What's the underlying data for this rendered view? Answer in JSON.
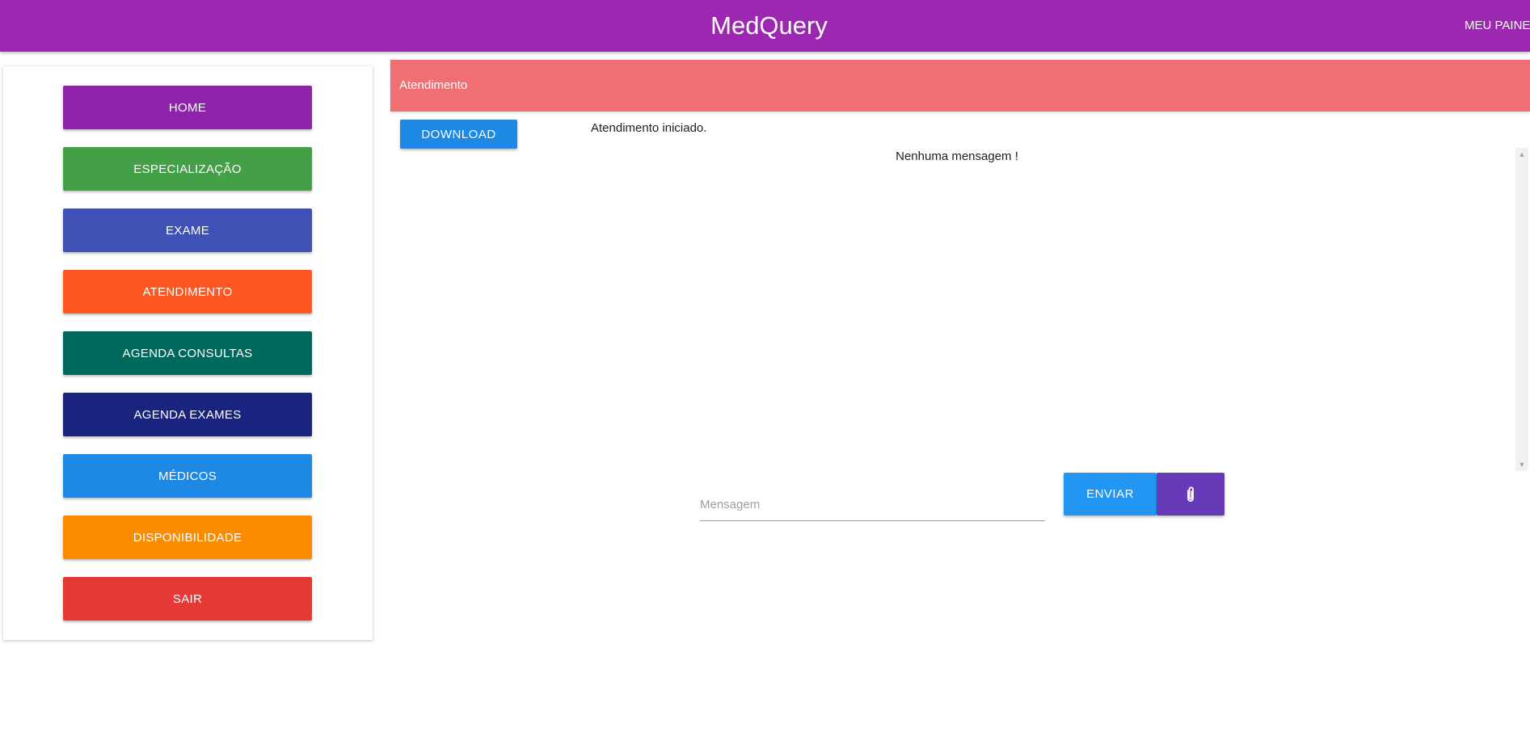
{
  "app": {
    "title": "MedQuery",
    "panel_link": "MEU PAINEL"
  },
  "colors": {
    "appbar": "#9c27b0",
    "chat_header": "#ef6f72",
    "download": "#1e88e5",
    "send": "#2196f3",
    "attach": "#673ab7"
  },
  "sidebar": {
    "items": [
      {
        "label": "HOME",
        "color": "#8e24aa"
      },
      {
        "label": "ESPECIALIZAÇÃO",
        "color": "#43a047"
      },
      {
        "label": "EXAME",
        "color": "#3f51b5"
      },
      {
        "label": "ATENDIMENTO",
        "color": "#ff5722"
      },
      {
        "label": "AGENDA CONSULTAS",
        "color": "#00695c"
      },
      {
        "label": "AGENDA EXAMES",
        "color": "#1a237e"
      },
      {
        "label": "MÉDICOS",
        "color": "#1e88e5"
      },
      {
        "label": "DISPONIBILIDADE",
        "color": "#fb8c00"
      },
      {
        "label": "SAIR",
        "color": "#e53935"
      }
    ]
  },
  "chat": {
    "header_title": "Atendimento",
    "download_label": "DOWNLOAD",
    "status": "Atendimento iniciado.",
    "empty_message": "Nenhuma mensagem !",
    "input_placeholder": "Mensagem",
    "input_value": "",
    "send_label": "ENVIAR",
    "attach_icon": "paperclip-icon"
  }
}
